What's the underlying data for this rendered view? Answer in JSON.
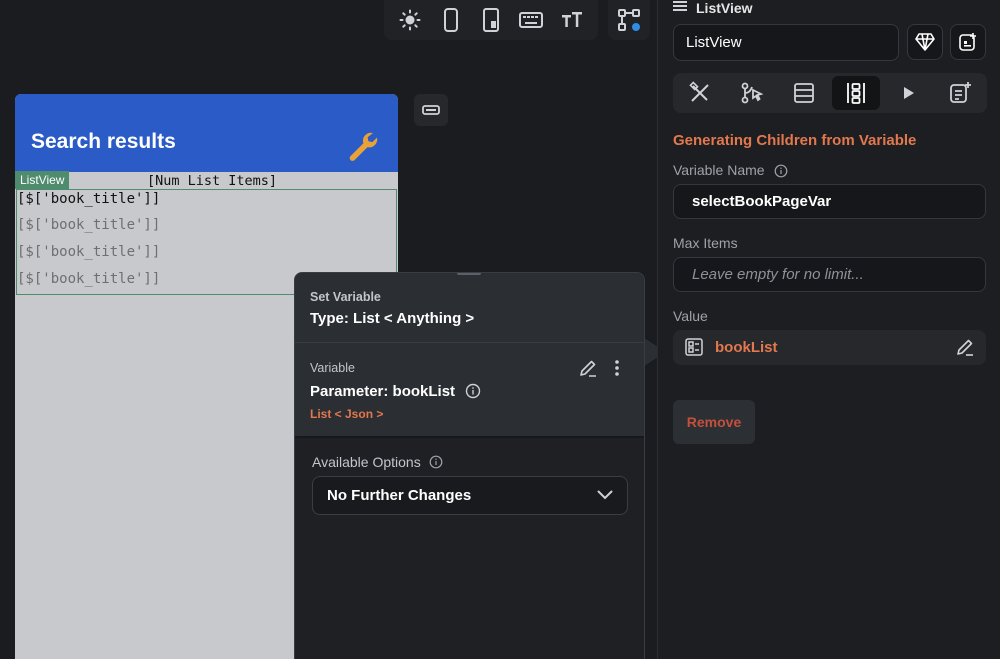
{
  "colors": {
    "accent": "#e2784e",
    "app_bar": "#2a5bc6",
    "list_tag": "#4f8b6d",
    "danger": "#c4503c"
  },
  "toolbar": {
    "icons": [
      "sun-icon",
      "phone-portrait-icon",
      "tablet-icon",
      "keyboard-icon",
      "text-size-icon",
      "flow-nodes-icon"
    ]
  },
  "preview": {
    "app_title": "Search results",
    "listview_tag": "ListView",
    "num_items": "[Num List Items]",
    "rows": [
      "[$['book_title']]",
      "[$['book_title']]",
      "[$['book_title']]",
      "[$['book_title']]"
    ]
  },
  "popup": {
    "header_small": "Set Variable",
    "header_type": "Type: List < Anything >",
    "variable_label": "Variable",
    "variable_name": "Parameter: bookList",
    "variable_type": "List < Json >",
    "options_label": "Available Options",
    "options_value": "No Further Changes"
  },
  "panel": {
    "header": "ListView",
    "name_value": "ListView",
    "section_title": "Generating Children from Variable",
    "var_name_label": "Variable Name",
    "var_name_value": "selectBookPageVar",
    "max_items_label": "Max Items",
    "max_items_placeholder": "Leave empty for no limit...",
    "value_label": "Value",
    "value_text": "bookList",
    "remove_label": "Remove",
    "tabs": [
      "properties-icon",
      "actions-icon",
      "backend-query-icon",
      "generate-children-icon",
      "play-icon",
      "docs-icon"
    ]
  }
}
